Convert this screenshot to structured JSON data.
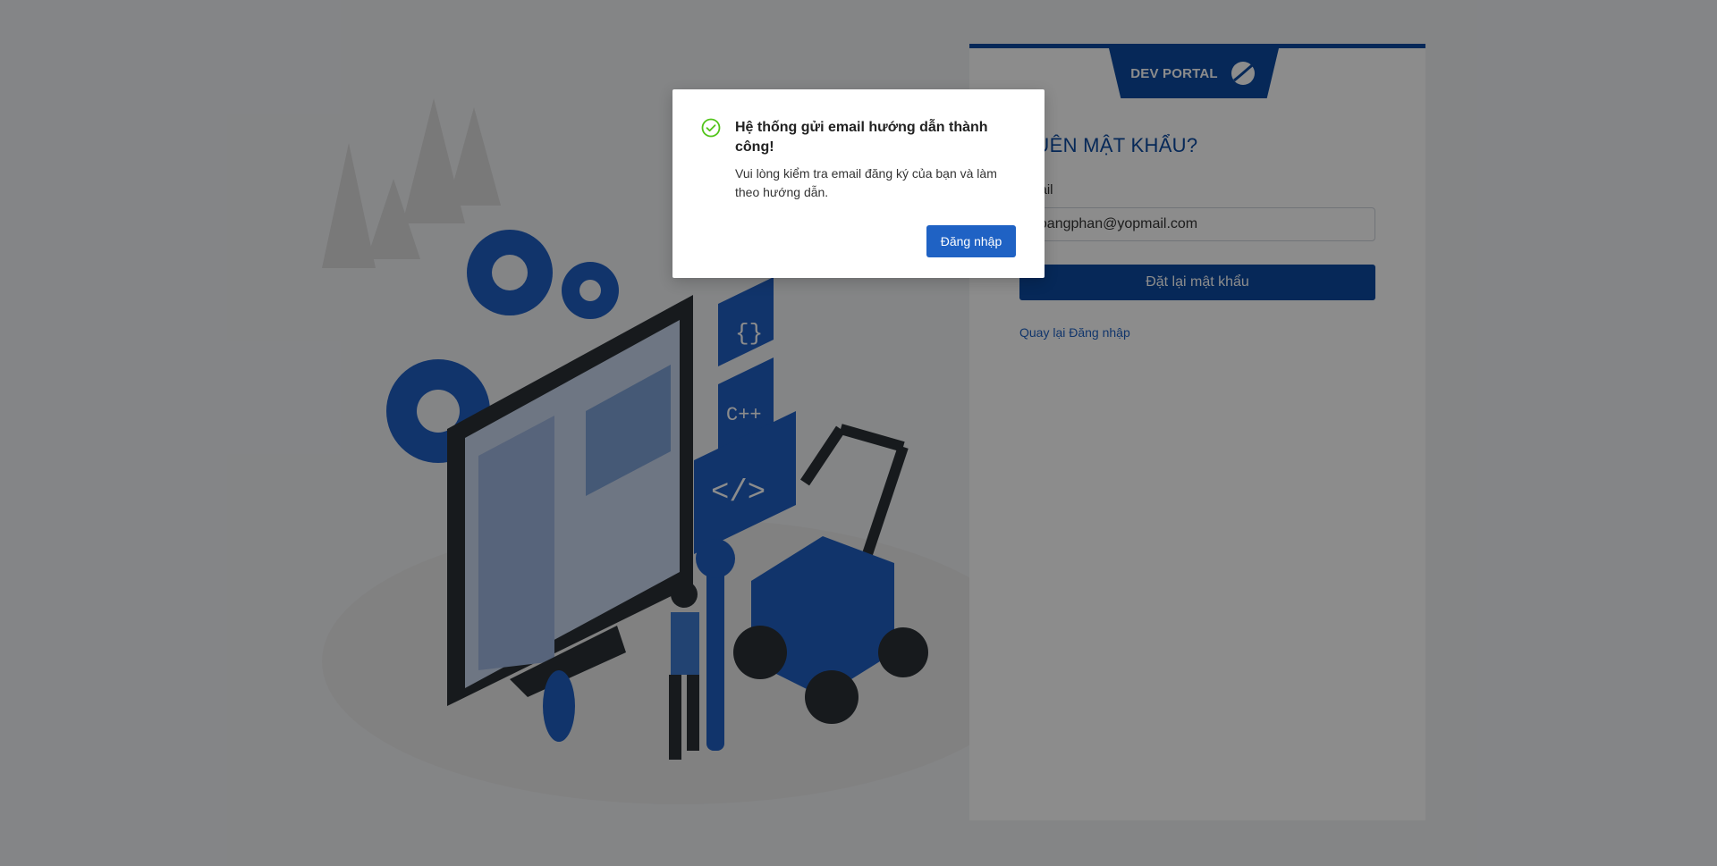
{
  "brand": {
    "name": "DEV PORTAL",
    "logo_icon": "globe-swoosh-icon"
  },
  "form": {
    "title": "QUÊN MẬT KHẨU?",
    "email_label": "Email",
    "email_value": "hoangphan@yopmail.com",
    "submit_label": "Đặt lại mật khẩu",
    "back_link": "Quay lại Đăng nhập"
  },
  "modal": {
    "icon": "check-circle-icon",
    "title": "Hệ thống gửi email hướng dẫn thành công!",
    "body": "Vui lòng kiểm tra email đăng ký của bạn và làm theo hướng dẫn.",
    "button_label": "Đăng nhập"
  },
  "colors": {
    "primary": "#0b4aa0",
    "link": "#1f62c4",
    "success": "#52c41a",
    "overlay": "rgba(0,0,0,0.45)"
  }
}
